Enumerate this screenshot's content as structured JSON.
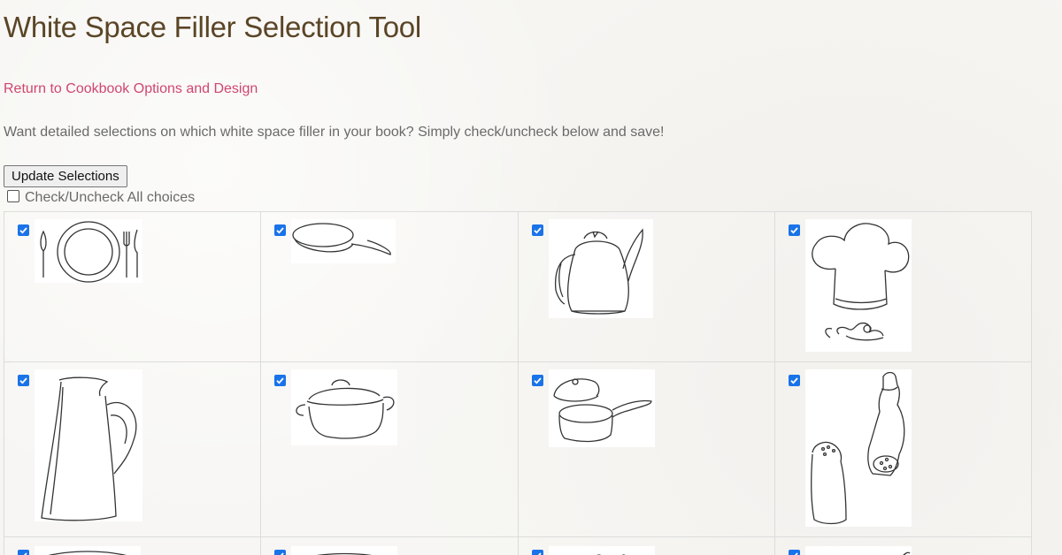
{
  "page": {
    "title": "White Space Filler Selection Tool",
    "back_link": "Return to Cookbook Options and Design",
    "intro": "Want detailed selections on which white space filler in your book? Simply check/uncheck below and save!",
    "update_button": "Update Selections",
    "check_all_label": "Check/Uncheck All choices",
    "check_all_checked": false
  },
  "fillers": [
    {
      "icon": "place-setting-icon",
      "checked": true
    },
    {
      "icon": "frying-pan-icon",
      "checked": true
    },
    {
      "icon": "teakettle-icon",
      "checked": true
    },
    {
      "icon": "chef-hat-icon",
      "checked": true
    },
    {
      "icon": "pitcher-icon",
      "checked": true
    },
    {
      "icon": "dutch-oven-icon",
      "checked": true
    },
    {
      "icon": "saucepan-icon",
      "checked": true
    },
    {
      "icon": "salt-pepper-shakers-icon",
      "checked": true
    },
    {
      "icon": "filler-icon",
      "checked": true
    },
    {
      "icon": "filler-icon",
      "checked": true
    },
    {
      "icon": "filler-icon",
      "checked": true
    },
    {
      "icon": "filler-icon",
      "checked": true
    }
  ],
  "colors": {
    "title": "#5a4526",
    "link": "#d0466f",
    "text": "#6a6a6a",
    "checkbox": "#1a73e8",
    "line_art": "#333333"
  }
}
